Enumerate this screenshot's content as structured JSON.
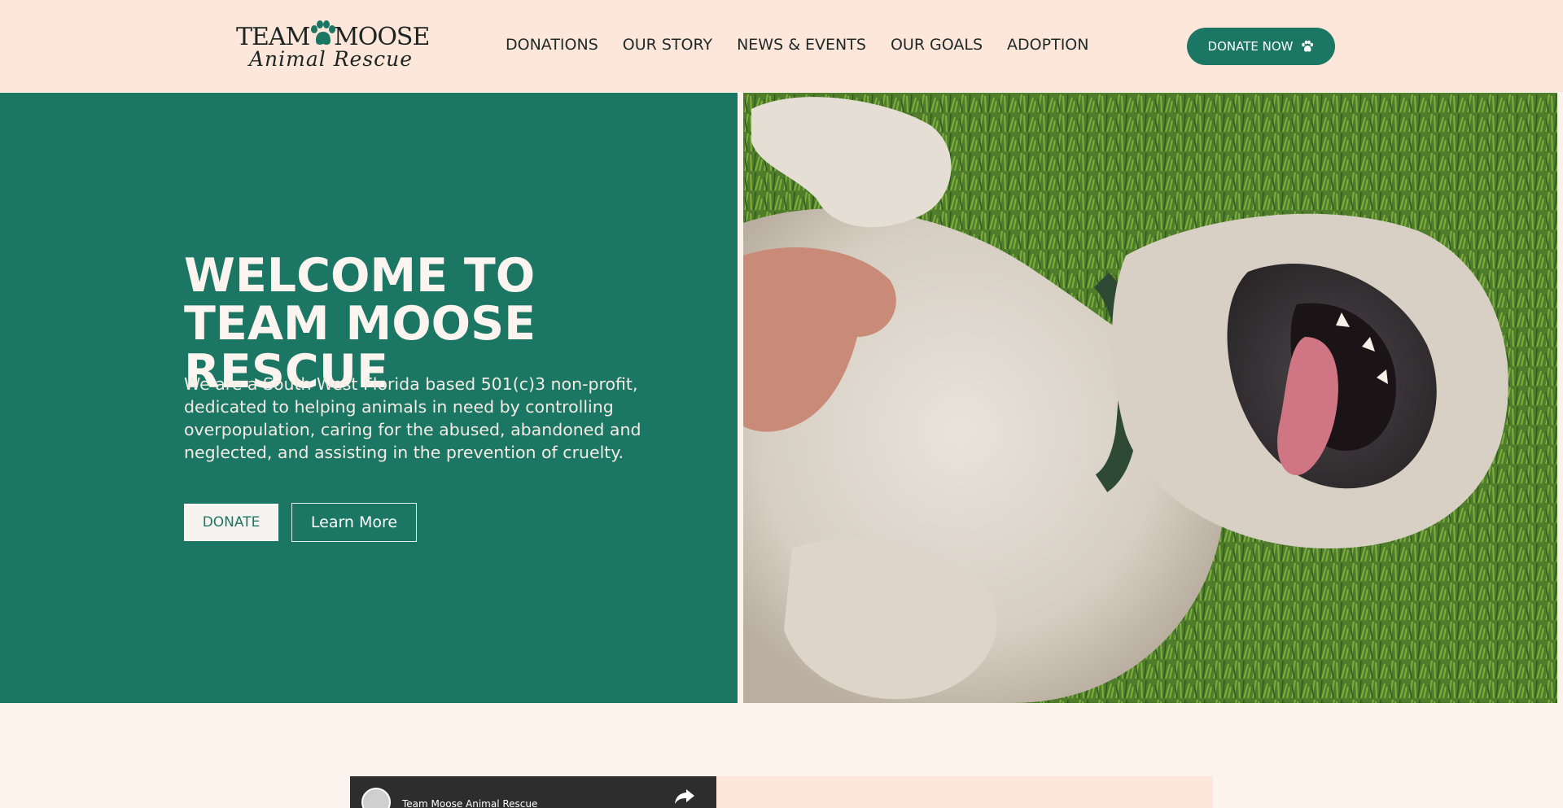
{
  "brand": {
    "logo_line1_left": "TEAM",
    "logo_line1_right": "MOOSE",
    "logo_line2": "Animal Rescue",
    "logo_icon": "paw-icon",
    "accent_color": "#1b7663",
    "header_bg": "#fde6da",
    "page_bg": "#fdf3ed"
  },
  "nav": {
    "items": [
      {
        "label": "DONATIONS"
      },
      {
        "label": "OUR STORY"
      },
      {
        "label": "NEWS & EVENTS"
      },
      {
        "label": "OUR GOALS"
      },
      {
        "label": "ADOPTION"
      }
    ],
    "cta_label": "DONATE NOW",
    "cta_icon": "paw-icon"
  },
  "hero": {
    "title": "WELCOME TO TEAM MOOSE RESCUE",
    "text": "We are a South West Florida based 501(c)3 non-profit, dedicated to helping animals in need by controlling overpopulation, caring for the abused, abandoned and neglected, and assisting in the prevention of cruelty.",
    "primary_button": "DONATE",
    "secondary_button": "Learn More"
  },
  "video": {
    "channel_title": "Team Moose Animal Rescue",
    "share_icon": "share-icon"
  }
}
